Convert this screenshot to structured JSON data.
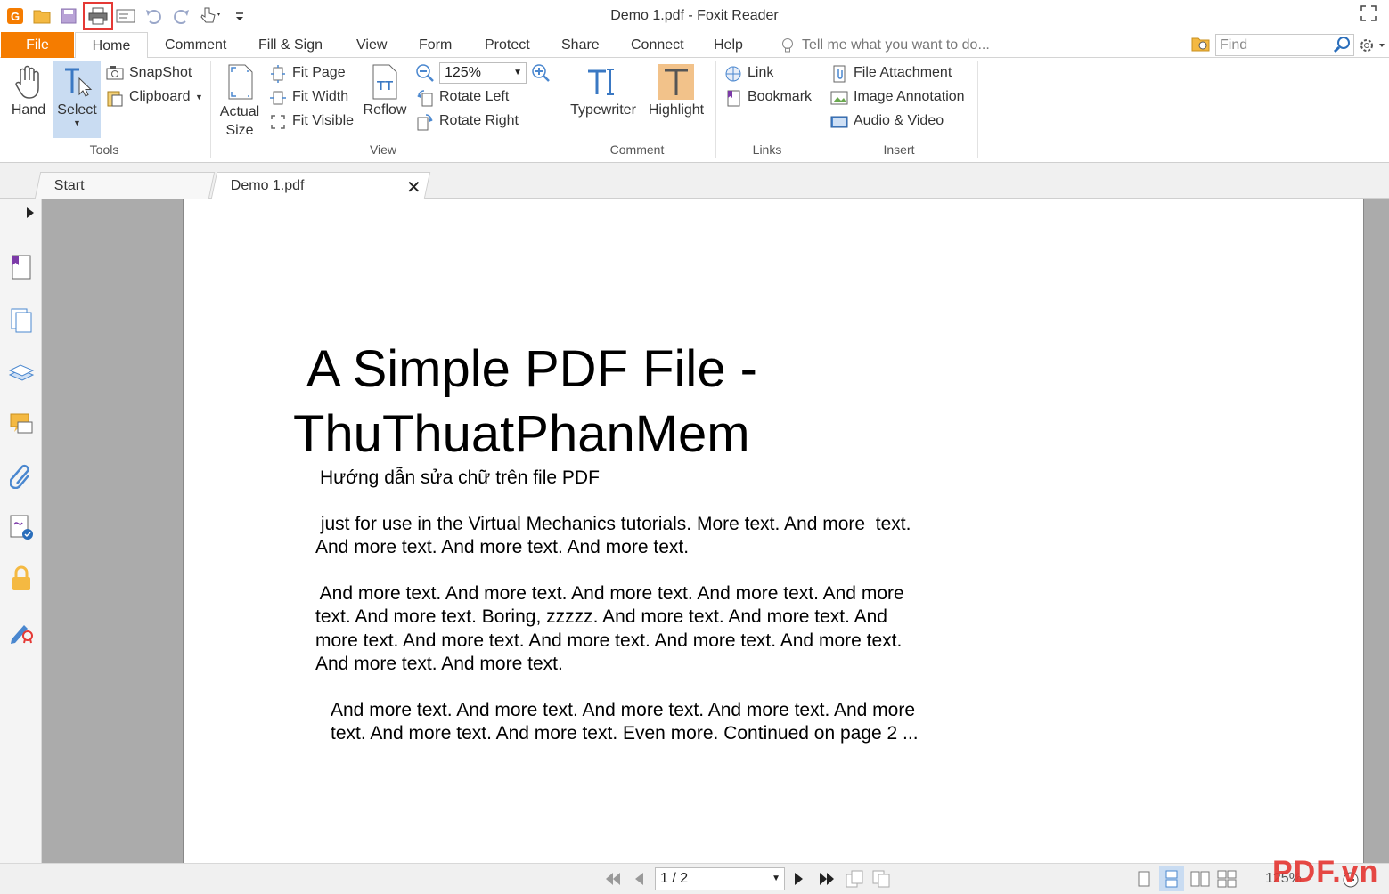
{
  "window": {
    "title": "Demo 1.pdf - Foxit Reader"
  },
  "quick_access": {
    "icons": [
      "app-logo-icon",
      "open-icon",
      "save-icon",
      "print-icon",
      "screen-icon",
      "undo-icon",
      "redo-icon",
      "touch-icon",
      "customize-icon"
    ]
  },
  "menu": {
    "tabs": [
      "File",
      "Home",
      "Comment",
      "Fill & Sign",
      "View",
      "Form",
      "Protect",
      "Share",
      "Connect",
      "Help"
    ],
    "tell_me": "Tell me what you want to do...",
    "find_placeholder": "Find"
  },
  "ribbon": {
    "tools": {
      "hand": "Hand",
      "select": "Select",
      "snapshot": "SnapShot",
      "clipboard": "Clipboard",
      "group": "Tools"
    },
    "view": {
      "actual_size_1": "Actual",
      "actual_size_2": "Size",
      "fit_page": "Fit Page",
      "fit_width": "Fit Width",
      "fit_visible": "Fit Visible",
      "reflow": "Reflow",
      "zoom_value": "125%",
      "rotate_left": "Rotate Left",
      "rotate_right": "Rotate Right",
      "group": "View"
    },
    "comment": {
      "typewriter": "Typewriter",
      "highlight": "Highlight",
      "group": "Comment"
    },
    "links": {
      "link": "Link",
      "bookmark": "Bookmark",
      "group": "Links"
    },
    "insert": {
      "file_attachment": "File Attachment",
      "image_annotation": "Image Annotation",
      "audio_video": "Audio & Video",
      "group": "Insert"
    }
  },
  "doc_tabs": {
    "start": "Start",
    "demo": "Demo 1.pdf"
  },
  "document": {
    "title_line1": "A Simple PDF File -",
    "title_line2": "ThuThuatPhanMem",
    "subtitle": "Hướng dẫn sửa chữ trên file PDF",
    "para1": " just for use in the Virtual Mechanics tutorials. More text. And more  text.\nAnd more text. And more text. And more text.",
    "para2": " And more text. And more text. And more text. And more text. And more\ntext. And more text. Boring, zzzzz. And more text. And more text. And\nmore text. And more text. And more text. And more text. And more text.\nAnd more text. And more text.",
    "para3": "And more text. And more text. And more text. And more text. And more\ntext. And more text. And more text. Even more. Continued on page 2 ..."
  },
  "status": {
    "page": "1 / 2",
    "zoom": "125%"
  },
  "watermark": "PDF.vn",
  "colors": {
    "accent": "#f57c00",
    "select_bg": "#c9dcf2",
    "arrow": "#e53935"
  }
}
